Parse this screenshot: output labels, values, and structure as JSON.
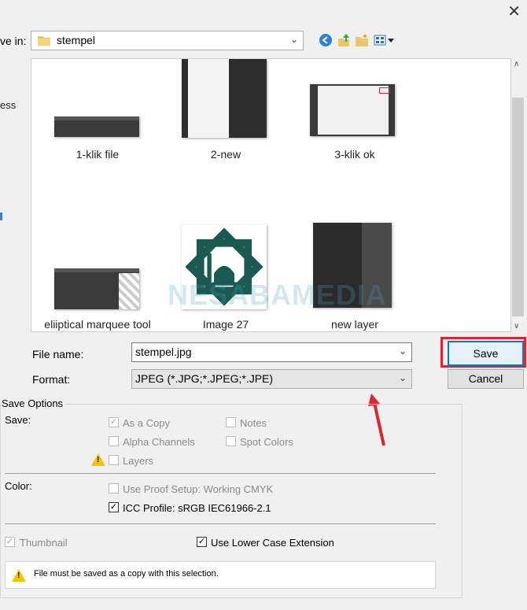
{
  "toolbar": {
    "save_in_label": "ve in:",
    "save_in_value": "stempel",
    "close_icon": "close-icon"
  },
  "left_edge": {
    "fragment_1": "ess"
  },
  "files": [
    {
      "name": "1-klik file"
    },
    {
      "name": "2-new"
    },
    {
      "name": "3-klik ok"
    },
    {
      "name": "eliiptical marquee tool"
    },
    {
      "name": "Image 27"
    },
    {
      "name": "new layer"
    }
  ],
  "watermark": "NESABAMEDIA",
  "form": {
    "file_name_label": "File name:",
    "file_name_value": "stempel.jpg",
    "format_label": "Format:",
    "format_value": "JPEG (*.JPG;*.JPEG;*.JPE)",
    "save_button": "Save",
    "cancel_button": "Cancel"
  },
  "save_options": {
    "title": "Save Options",
    "save_label": "Save:",
    "as_a_copy": {
      "label": "As a Copy",
      "checked": true,
      "disabled": true
    },
    "notes": {
      "label": "Notes",
      "checked": false,
      "disabled": true
    },
    "alpha_channels": {
      "label": "Alpha Channels",
      "checked": false,
      "disabled": true
    },
    "spot_colors": {
      "label": "Spot Colors",
      "checked": false,
      "disabled": true
    },
    "layers": {
      "label": "Layers",
      "checked": false,
      "disabled": true
    },
    "color_label": "Color:",
    "use_proof_setup": {
      "label": "Use Proof Setup:  Working CMYK",
      "checked": false,
      "disabled": true
    },
    "icc_profile": {
      "label": "ICC Profile:  sRGB IEC61966-2.1",
      "checked": true,
      "disabled": false
    },
    "thumbnail": {
      "label": "Thumbnail",
      "checked": true,
      "disabled": true
    },
    "lower_case_ext": {
      "label": "Use Lower Case Extension",
      "checked": true,
      "disabled": false
    },
    "info_message": "File must be saved as a copy with this selection."
  },
  "colors": {
    "highlight_red": "#d9262f",
    "accent_blue": "#0078d7"
  }
}
